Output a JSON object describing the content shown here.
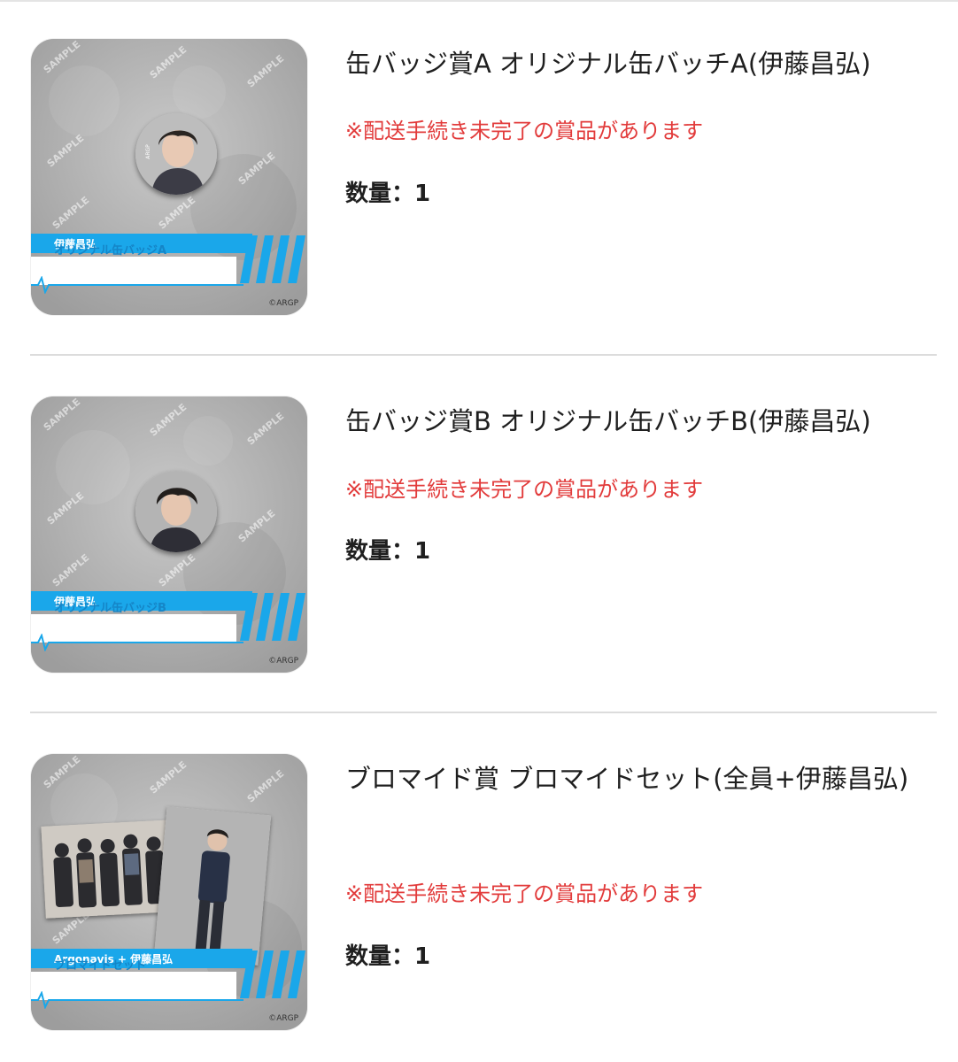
{
  "items": [
    {
      "title": "缶バッジ賞A オリジナル缶バッチA(伊藤昌弘)",
      "notice": "※配送手続き未完了の賞品があります",
      "quantity_label": "数量：",
      "quantity": "1",
      "thumb": {
        "watermark": "SAMPLE",
        "band_top": "伊藤昌弘",
        "band_bottom": "オリジナル缶バッジA",
        "badge_mark": "ARGP",
        "copyright": "©ARGP"
      }
    },
    {
      "title": "缶バッジ賞B オリジナル缶バッチB(伊藤昌弘)",
      "notice": "※配送手続き未完了の賞品があります",
      "quantity_label": "数量：",
      "quantity": "1",
      "thumb": {
        "watermark": "SAMPLE",
        "band_top": "伊藤昌弘",
        "band_bottom": "オリジナル缶バッジB",
        "copyright": "©ARGP"
      }
    },
    {
      "title": "ブロマイド賞 ブロマイドセット(全員+伊藤昌弘)",
      "notice": "※配送手続き未完了の賞品があります",
      "quantity_label": "数量：",
      "quantity": "1",
      "thumb": {
        "watermark": "SAMPLE",
        "band_top": "Argonavis + 伊藤昌弘",
        "band_bottom": "ブロマイドセット",
        "copyright": "©ARGP"
      }
    }
  ],
  "colors": {
    "notice": "#e23b3b",
    "band": "#1aa7ea",
    "divider": "#dcdcdc"
  }
}
